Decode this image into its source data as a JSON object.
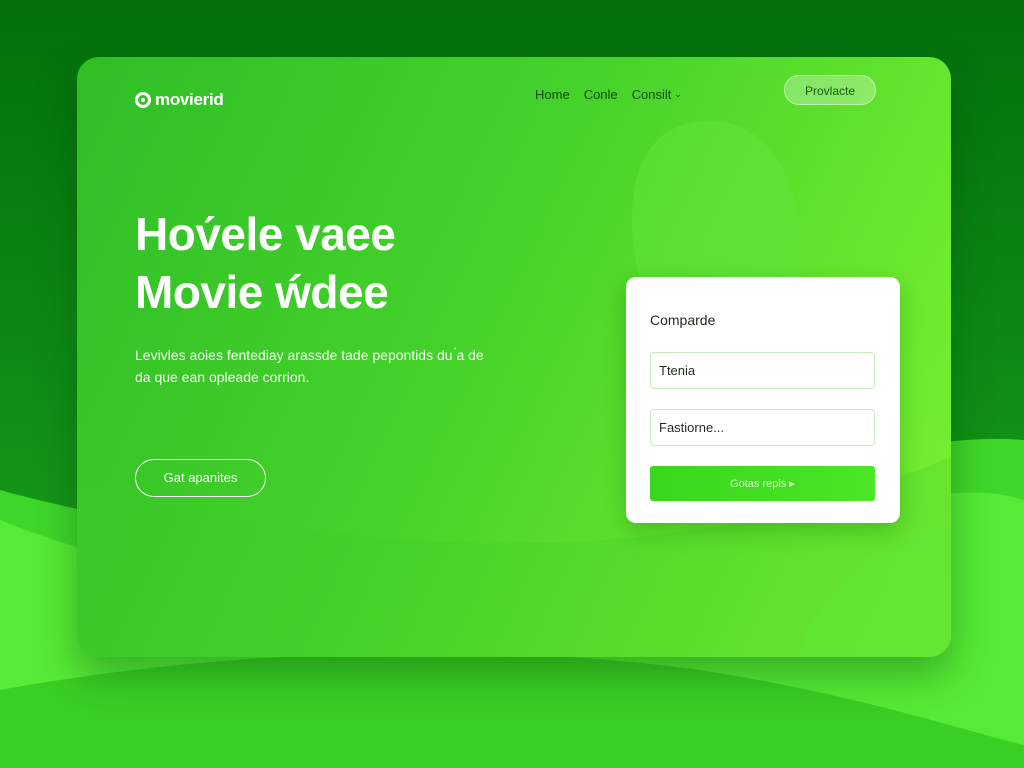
{
  "brand": {
    "logo_text": "movierid"
  },
  "nav": {
    "items": [
      {
        "label": "Home"
      },
      {
        "label": "Conle"
      },
      {
        "label": "Consilt"
      }
    ],
    "cta_label": "Provlacte"
  },
  "hero": {
    "title_line1": "Hov́ele vaee",
    "title_line2": "Movie ẃdee",
    "description": "Levivles aoies fentediay arassde tade pepontids du ́a de da que ean opleade corrion.",
    "cta_label": "Gat apanites"
  },
  "form": {
    "title": "Comparde",
    "field1_placeholder": "Ttenia",
    "field2_placeholder": "Fastiorne...",
    "submit_label": "Gotas repls ▸"
  },
  "colors": {
    "accent": "#4be624",
    "background_dark": "#046f0c",
    "card_start": "#2fbf26",
    "card_end": "#7cf031"
  }
}
